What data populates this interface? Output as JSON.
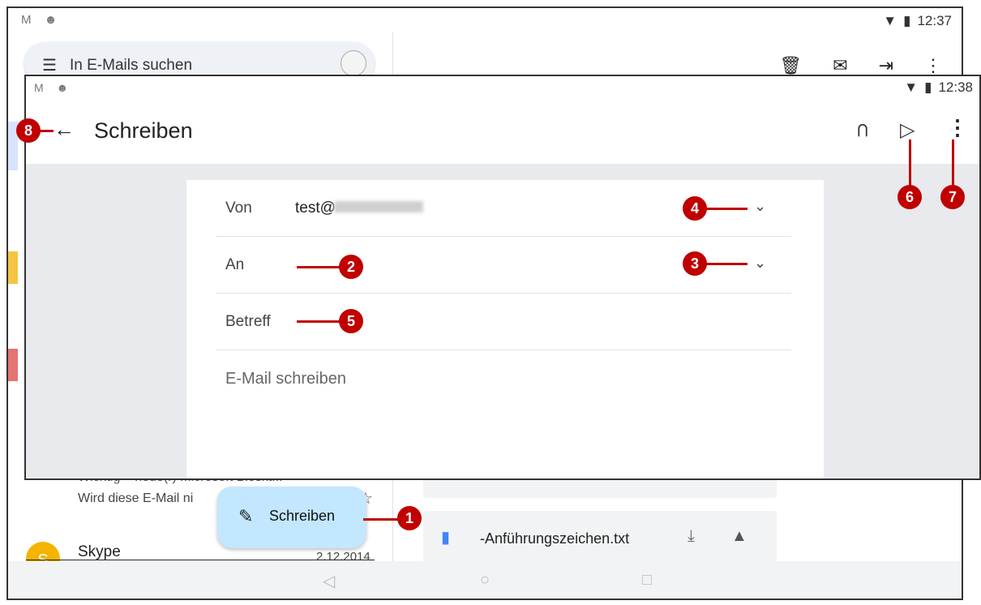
{
  "back_screen": {
    "status": {
      "left_icons": "M ☻",
      "time": "12:37"
    },
    "search": {
      "placeholder": "In E-Mails suchen"
    },
    "mail_row": {
      "line1": "Wichtig – neue(r) Microsoft Bioskt...",
      "line2": "Wird diese E-Mail ni"
    },
    "skype": {
      "avatar_letter": "S",
      "name": "Skype",
      "date": "2.12.2014"
    },
    "attachment": {
      "filename": "-Anführungszeichen.txt"
    },
    "fab_label": "Schreiben"
  },
  "front_screen": {
    "status": {
      "left_icons": "M ☻",
      "time": "12:38"
    },
    "title": "Schreiben",
    "from_label": "Von",
    "from_value": "test@",
    "to_label": "An",
    "subject_label": "Betreff",
    "body_placeholder": "E-Mail schreiben"
  },
  "callouts": {
    "c1": "1",
    "c2": "2",
    "c3": "3",
    "c4": "4",
    "c5": "5",
    "c6": "6",
    "c7": "7",
    "c8": "8"
  },
  "colors": {
    "callout": "#c00000",
    "fab": "#c2e7ff",
    "compose_bg": "#e8eaed"
  },
  "icons": [
    "menu-icon",
    "trash-icon",
    "mail-icon",
    "move-icon",
    "more-icon",
    "back-arrow-icon",
    "attach-icon",
    "send-icon",
    "chevron-down-icon",
    "pencil-icon",
    "doc-icon",
    "download-icon",
    "drive-icon"
  ]
}
